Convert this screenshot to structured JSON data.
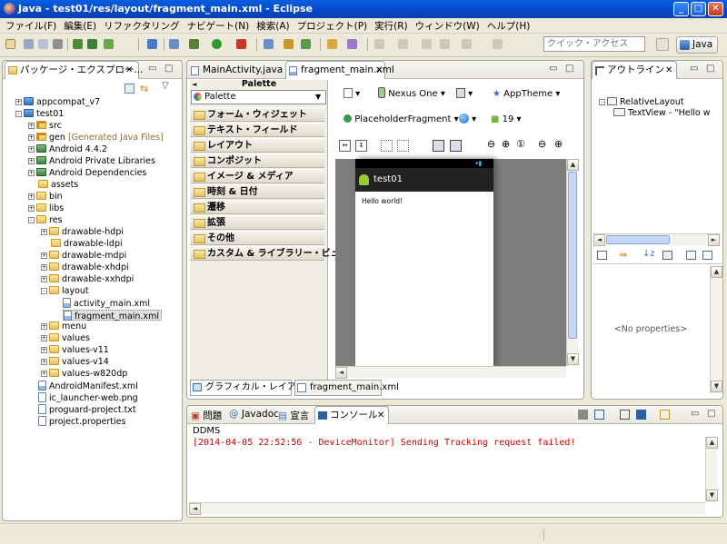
{
  "window": {
    "title": "Java - test01/res/layout/fragment_main.xml - Eclipse",
    "min": "_",
    "max": "□",
    "close": "✕"
  },
  "menu": [
    "ファイル(F)",
    "編集(E)",
    "リファクタリング",
    "ナビゲート(N)",
    "検索(A)",
    "プロジェクト(P)",
    "実行(R)",
    "ウィンドウ(W)",
    "ヘルプ(H)"
  ],
  "toolbar": {
    "quick_access_placeholder": "クイック・アクセス",
    "perspective": "Java"
  },
  "package_explorer": {
    "title": "パッケージ・エクスプロー...",
    "items": [
      {
        "label": "appcompat_v7"
      },
      {
        "label": "test01"
      },
      {
        "label": "src"
      },
      {
        "label": "gen",
        "extra": "[Generated Java Files]"
      },
      {
        "label": "Android 4.4.2"
      },
      {
        "label": "Android Private Libraries"
      },
      {
        "label": "Android Dependencies"
      },
      {
        "label": "assets"
      },
      {
        "label": "bin"
      },
      {
        "label": "libs"
      },
      {
        "label": "res"
      },
      {
        "label": "drawable-hdpi"
      },
      {
        "label": "drawable-ldpi"
      },
      {
        "label": "drawable-mdpi"
      },
      {
        "label": "drawable-xhdpi"
      },
      {
        "label": "drawable-xxhdpi"
      },
      {
        "label": "layout"
      },
      {
        "label": "activity_main.xml"
      },
      {
        "label": "fragment_main.xml"
      },
      {
        "label": "menu"
      },
      {
        "label": "values"
      },
      {
        "label": "values-v11"
      },
      {
        "label": "values-v14"
      },
      {
        "label": "values-w820dp"
      },
      {
        "label": "AndroidManifest.xml"
      },
      {
        "label": "ic_launcher-web.png"
      },
      {
        "label": "proguard-project.txt"
      },
      {
        "label": "project.properties"
      }
    ]
  },
  "editor": {
    "tabs": [
      "MainActivity.java",
      "fragment_main.xml"
    ],
    "palette_header": "Palette",
    "palette_select": "Palette",
    "palette_categories": [
      "フォーム・ウィジェット",
      "テキスト・フィールド",
      "レイアウト",
      "コンポジット",
      "イメージ & メディア",
      "時刻 & 日付",
      "遷移",
      "拡張",
      "その他",
      "カスタム & ライブラリー・ビュー"
    ],
    "device": "Nexus One",
    "theme": "AppTheme",
    "fragment": "PlaceholderFragment",
    "api": "19",
    "app_title": "test01",
    "hello": "Hello world!",
    "bottom_tabs": [
      "グラフィカル・レイアウト",
      "fragment_main.xml"
    ]
  },
  "outline": {
    "title": "アウトライン",
    "items": [
      "RelativeLayout",
      "TextView - \"Hello w"
    ],
    "no_properties": "<No properties>"
  },
  "console": {
    "tabs": [
      "問題",
      "Javadoc",
      "宣言",
      "コンソール"
    ],
    "name": "DDMS",
    "text": "[2014-04-05 22:52:56 - DeviceMonitor] Sending Tracking request failed!"
  }
}
